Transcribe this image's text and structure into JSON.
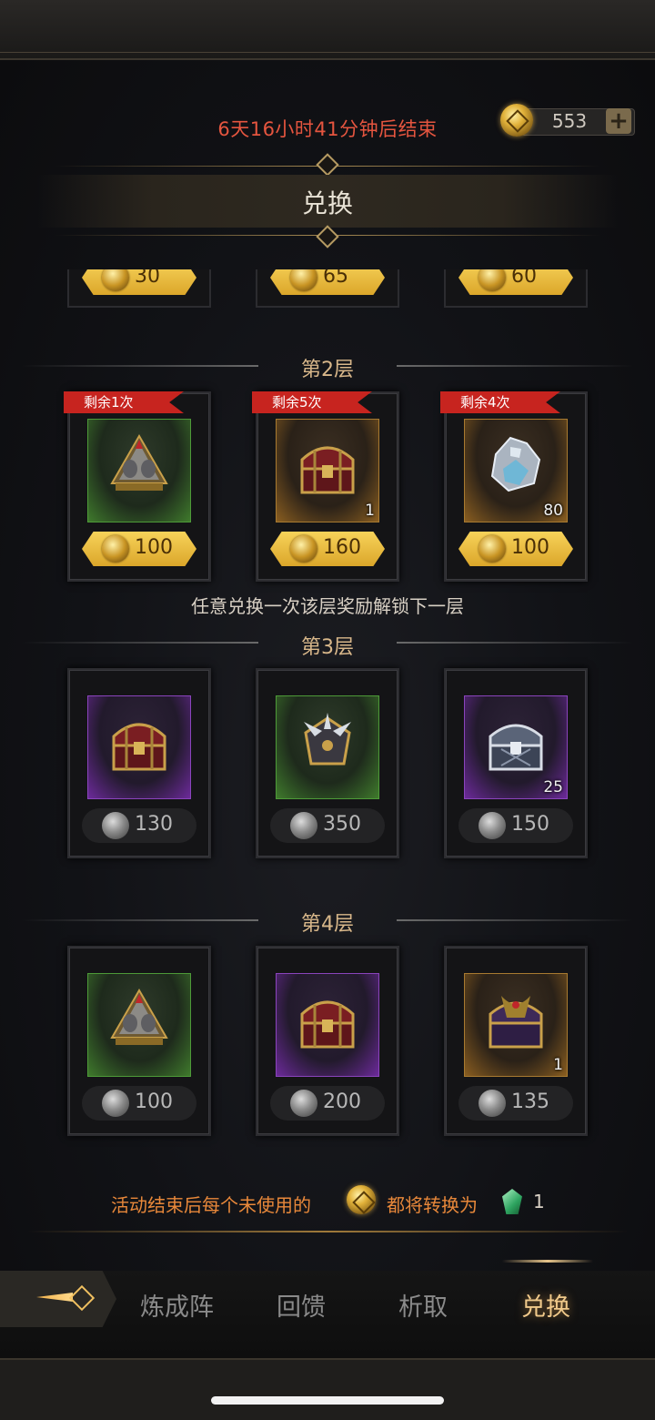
{
  "header": {
    "timer": "6天16小时41分钟后结束",
    "currency_value": "553",
    "title": "兑换"
  },
  "tier1_partial": [
    {
      "price": "30"
    },
    {
      "price": "65"
    },
    {
      "price": "60"
    }
  ],
  "tier2": {
    "label": "第2层",
    "items": [
      {
        "ribbon": "剩余1次",
        "quantity": "",
        "price": "100",
        "rarity": "green",
        "icon": "helmet-icon"
      },
      {
        "ribbon": "剩余5次",
        "quantity": "1",
        "price": "160",
        "rarity": "orange",
        "icon": "treasure-chest-icon"
      },
      {
        "ribbon": "剩余4次",
        "quantity": "80",
        "price": "100",
        "rarity": "orange",
        "icon": "crystal-ore-icon"
      }
    ],
    "hint": "任意兑换一次该层奖励解锁下一层"
  },
  "tier3": {
    "label": "第3层",
    "items": [
      {
        "quantity": "",
        "price": "130",
        "rarity": "purple",
        "icon": "treasure-chest-icon"
      },
      {
        "quantity": "",
        "price": "350",
        "rarity": "green",
        "icon": "armor-icon"
      },
      {
        "quantity": "25",
        "price": "150",
        "rarity": "purple",
        "icon": "silver-chest-icon"
      }
    ]
  },
  "tier4": {
    "label": "第4层",
    "items": [
      {
        "quantity": "",
        "price": "100",
        "rarity": "green",
        "icon": "helmet-icon"
      },
      {
        "quantity": "",
        "price": "200",
        "rarity": "purple",
        "icon": "treasure-chest-icon"
      },
      {
        "quantity": "1",
        "price": "135",
        "rarity": "orange",
        "icon": "dark-chest-icon"
      }
    ]
  },
  "footer_note": {
    "part1": "活动结束后每个未使用的",
    "part2": "都将转换为",
    "amount": "1"
  },
  "nav": {
    "tabs": [
      "炼成阵",
      "回馈",
      "析取",
      "兑换"
    ],
    "active": "兑换"
  }
}
